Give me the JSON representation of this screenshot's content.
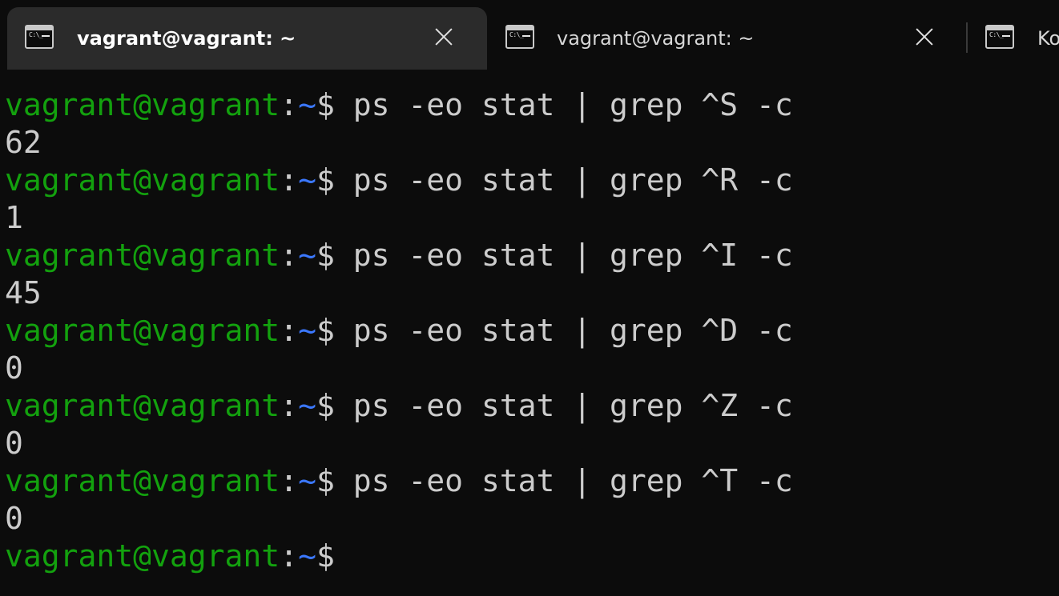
{
  "tabs": [
    {
      "title": "vagrant@vagrant: ~",
      "icon": "terminal-icon",
      "prompt_glyph": "C:\\_",
      "active": true
    },
    {
      "title": "vagrant@vagrant: ~",
      "icon": "terminal-icon",
      "prompt_glyph": "C:\\_",
      "active": false
    },
    {
      "title": "Ko",
      "icon": "terminal-icon",
      "prompt_glyph": "C:\\_",
      "active": false
    }
  ],
  "prompt": {
    "user_host": "vagrant@vagrant",
    "colon": ":",
    "path": "~",
    "dollar": "$"
  },
  "session": [
    {
      "command": " ps -eo stat | grep ^S -c",
      "output": "62"
    },
    {
      "command": " ps -eo stat | grep ^R -c",
      "output": "1"
    },
    {
      "command": " ps -eo stat | grep ^I -c",
      "output": "45"
    },
    {
      "command": " ps -eo stat | grep ^D -c",
      "output": "0"
    },
    {
      "command": " ps -eo stat | grep ^Z -c",
      "output": "0"
    },
    {
      "command": " ps -eo stat | grep ^T -c",
      "output": "0"
    }
  ],
  "colors": {
    "background": "#0c0c0c",
    "active_tab": "#2b2b2b",
    "prompt_user": "#13a10e",
    "prompt_path": "#3b78ff",
    "text": "#cccccc"
  }
}
